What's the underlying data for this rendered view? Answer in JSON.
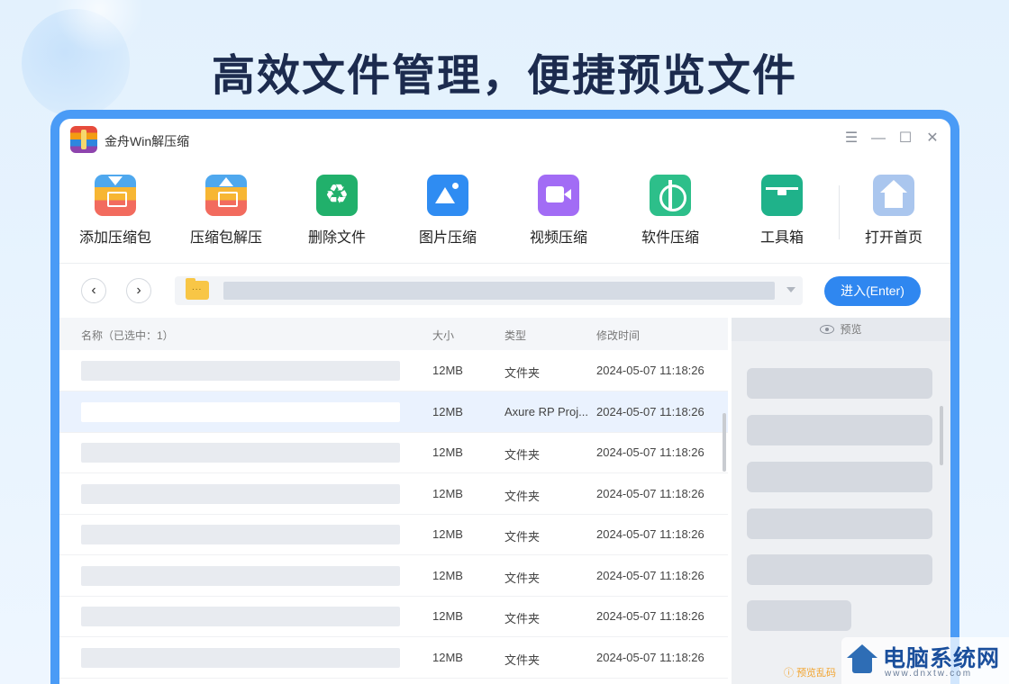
{
  "headline": "高效文件管理，便捷预览文件",
  "window": {
    "title": "金舟Win解压缩",
    "controls": [
      "menu-icon",
      "minimize-icon",
      "maximize-icon",
      "close-icon"
    ]
  },
  "toolbar": {
    "items": [
      {
        "label": "添加压缩包",
        "icon": "add-archive-icon"
      },
      {
        "label": "压缩包解压",
        "icon": "extract-archive-icon"
      },
      {
        "label": "删除文件",
        "icon": "recycle-icon"
      },
      {
        "label": "图片压缩",
        "icon": "image-compress-icon"
      },
      {
        "label": "视频压缩",
        "icon": "video-compress-icon"
      },
      {
        "label": "软件压缩",
        "icon": "software-compress-icon"
      },
      {
        "label": "工具箱",
        "icon": "toolbox-icon"
      },
      {
        "label": "打开首页",
        "icon": "home-icon"
      }
    ]
  },
  "nav": {
    "back": "‹",
    "forward": "›",
    "folder_label": "...",
    "enter_label": "进入(Enter)"
  },
  "list": {
    "headers": {
      "name": "名称（已选中：1）",
      "size": "大小",
      "type": "类型",
      "mtime": "修改时间"
    },
    "rows": [
      {
        "size": "12MB",
        "type": "文件夹",
        "mtime": "2024-05-07 11:18:26",
        "selected": false
      },
      {
        "size": "12MB",
        "type": "Axure RP Proj...",
        "mtime": "2024-05-07 11:18:26",
        "selected": true
      },
      {
        "size": "12MB",
        "type": "文件夹",
        "mtime": "2024-05-07 11:18:26",
        "selected": false
      },
      {
        "size": "12MB",
        "type": "文件夹",
        "mtime": "2024-05-07 11:18:26",
        "selected": false
      },
      {
        "size": "12MB",
        "type": "文件夹",
        "mtime": "2024-05-07 11:18:26",
        "selected": false
      },
      {
        "size": "12MB",
        "type": "文件夹",
        "mtime": "2024-05-07 11:18:26",
        "selected": false
      },
      {
        "size": "12MB",
        "type": "文件夹",
        "mtime": "2024-05-07 11:18:26",
        "selected": false
      },
      {
        "size": "12MB",
        "type": "文件夹",
        "mtime": "2024-05-07 11:18:26",
        "selected": false
      }
    ]
  },
  "preview": {
    "header": "预览",
    "hint": "预览乱码",
    "blocks": 6
  },
  "watermark": {
    "text": "电脑系统网",
    "sub": "www.dnxtw.com"
  },
  "colors": {
    "accent": "#2f87f0",
    "frame": "#4a9bf6",
    "headline": "#1c2b4e",
    "selected_row": "#eaf2fe"
  }
}
